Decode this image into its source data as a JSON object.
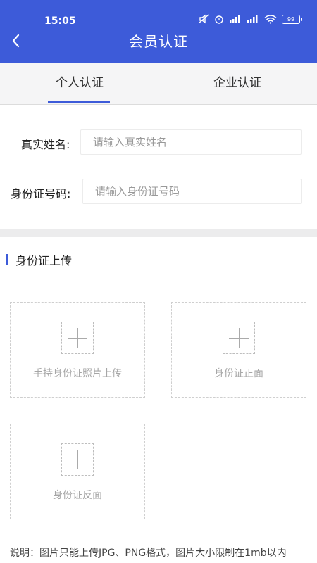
{
  "status_bar": {
    "time": "15:05",
    "battery": "99"
  },
  "header": {
    "title": "会员认证"
  },
  "tabs": [
    {
      "label": "个人认证",
      "active": true
    },
    {
      "label": "企业认证",
      "active": false
    }
  ],
  "form": {
    "name": {
      "label": "真实姓名:",
      "placeholder": "请输入真实姓名"
    },
    "id_number": {
      "label": "身份证号码:",
      "placeholder": "请输入身份证号码"
    }
  },
  "upload_section": {
    "title": "身份证上传",
    "slots": [
      {
        "label": "手持身份证照片上传"
      },
      {
        "label": "身份证正面"
      },
      {
        "label": "身份证反面"
      }
    ]
  },
  "note": "说明：图片只能上传JPG、PNG格式，图片大小限制在1mb以内",
  "colors": {
    "primary": "#3d5bd9",
    "divider": "#ececed"
  }
}
